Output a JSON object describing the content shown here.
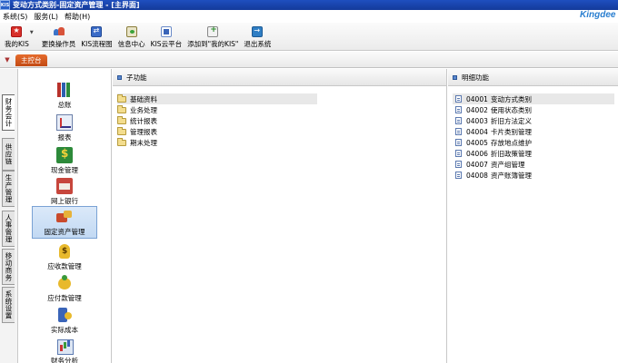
{
  "window": {
    "app_logo": "KIS",
    "title": "变动方式类别-固定资产管理 - [主界面]",
    "brand": "Kingdee"
  },
  "menu": [
    {
      "label": "系统(S)"
    },
    {
      "label": "服务(L)"
    },
    {
      "label": "帮助(H)"
    }
  ],
  "toolbar": [
    {
      "label": "我的KIS",
      "icon": "star-icon"
    },
    {
      "label": "更换操作员",
      "icon": "users-icon"
    },
    {
      "label": "KIS流程图",
      "icon": "flow-icon"
    },
    {
      "label": "信息中心",
      "icon": "info-icon"
    },
    {
      "label": "KIS云平台",
      "icon": "cloud-icon"
    },
    {
      "label": "添加到\"我的KIS\"",
      "icon": "add-icon"
    },
    {
      "label": "退出系统",
      "icon": "exit-icon"
    }
  ],
  "nav": {
    "collapse_glyph": "▼",
    "main_tab": "主控台"
  },
  "vertical_tabs": [
    {
      "label": "财务会计",
      "active": true
    },
    {
      "label": "供应链",
      "active": false
    },
    {
      "label": "生产管理",
      "active": false
    },
    {
      "label": "人事管理",
      "active": false
    },
    {
      "label": "移动商务",
      "active": false
    },
    {
      "label": "系统设置",
      "active": false
    }
  ],
  "modules": [
    {
      "label": "总账",
      "icon": "books-icon"
    },
    {
      "label": "报表",
      "icon": "report-icon"
    },
    {
      "label": "现金管理",
      "icon": "cash-icon"
    },
    {
      "label": "网上银行",
      "icon": "bank-icon"
    },
    {
      "label": "固定资产管理",
      "icon": "asset-icon",
      "selected": true
    },
    {
      "label": "应收款管理",
      "icon": "receivable-icon"
    },
    {
      "label": "应付款管理",
      "icon": "payable-icon"
    },
    {
      "label": "实际成本",
      "icon": "cost-icon"
    },
    {
      "label": "财务分析",
      "icon": "analysis-icon"
    }
  ],
  "sub_functions": {
    "header": "子功能",
    "items": [
      {
        "label": "基础资料",
        "selected": true
      },
      {
        "label": "业务处理"
      },
      {
        "label": "统计报表"
      },
      {
        "label": "管理报表"
      },
      {
        "label": "期末处理"
      }
    ]
  },
  "detail_functions": {
    "header": "明细功能",
    "items": [
      {
        "code": "04001",
        "name": "变动方式类别",
        "selected": true
      },
      {
        "code": "04002",
        "name": "使用状态类别"
      },
      {
        "code": "04003",
        "name": "折旧方法定义"
      },
      {
        "code": "04004",
        "name": "卡片类别管理"
      },
      {
        "code": "04005",
        "name": "存放地点维护"
      },
      {
        "code": "04006",
        "name": "折旧政策管理"
      },
      {
        "code": "04007",
        "name": "资产组管理"
      },
      {
        "code": "04008",
        "name": "资产账簿管理"
      }
    ]
  }
}
